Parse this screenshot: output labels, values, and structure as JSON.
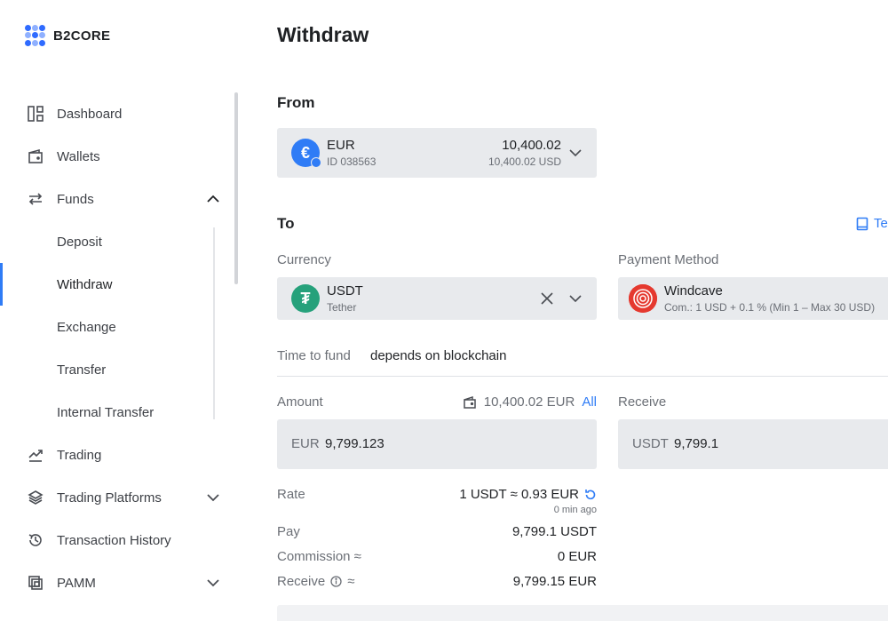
{
  "brand": {
    "name": "B2CORE"
  },
  "sidebar": {
    "items": [
      {
        "label": "Dashboard",
        "icon": "dashboard-icon"
      },
      {
        "label": "Wallets",
        "icon": "wallet-icon"
      },
      {
        "label": "Funds",
        "icon": "transfer-arrows-icon",
        "expanded": true
      },
      {
        "label": "Deposit"
      },
      {
        "label": "Withdraw",
        "active": true
      },
      {
        "label": "Exchange"
      },
      {
        "label": "Transfer"
      },
      {
        "label": "Internal Transfer"
      },
      {
        "label": "Trading",
        "icon": "trending-chart-icon"
      },
      {
        "label": "Trading Platforms",
        "icon": "layers-icon"
      },
      {
        "label": "Transaction History",
        "icon": "history-icon"
      },
      {
        "label": "PAMM",
        "icon": "pamm-icon"
      }
    ]
  },
  "page": {
    "title": "Withdraw"
  },
  "from": {
    "heading": "From",
    "currency": "EUR",
    "account_id": "ID 038563",
    "balance": "10,400.02",
    "balance_usd": "10,400.02 USD",
    "symbol": "€"
  },
  "to": {
    "heading": "To",
    "help_link": "Te",
    "currency_label": "Currency",
    "currency": "USDT",
    "currency_name": "Tether",
    "currency_symbol": "₮",
    "payment_label": "Payment Method",
    "payment_name": "Windcave",
    "payment_commission": "Com.: 1 USD + 0.1 % (Min 1 – Max 30 USD)",
    "time_label": "Time to fund",
    "time_value": "depends on blockchain"
  },
  "amount": {
    "label": "Amount",
    "available": "10,400.02 EUR",
    "all_label": "All",
    "currency": "EUR",
    "value": "9,799.123"
  },
  "receive": {
    "label": "Receive",
    "currency": "USDT",
    "value": "9,799.1"
  },
  "summary": {
    "rate_label": "Rate",
    "rate_value": "1 USDT ≈ 0.93 EUR",
    "rate_updated": "0 min ago",
    "pay_label": "Pay",
    "pay_value": "9,799.1 USDT",
    "commission_label": "Commission ≈",
    "commission_value": "0 EUR",
    "receive_label": "Receive",
    "receive_approx": "≈",
    "receive_value": "9,799.15 EUR"
  },
  "colors": {
    "accent": "#2f7cf6",
    "field_bg": "#e8eaed",
    "tether": "#26a17b",
    "windcave": "#e5392f"
  }
}
